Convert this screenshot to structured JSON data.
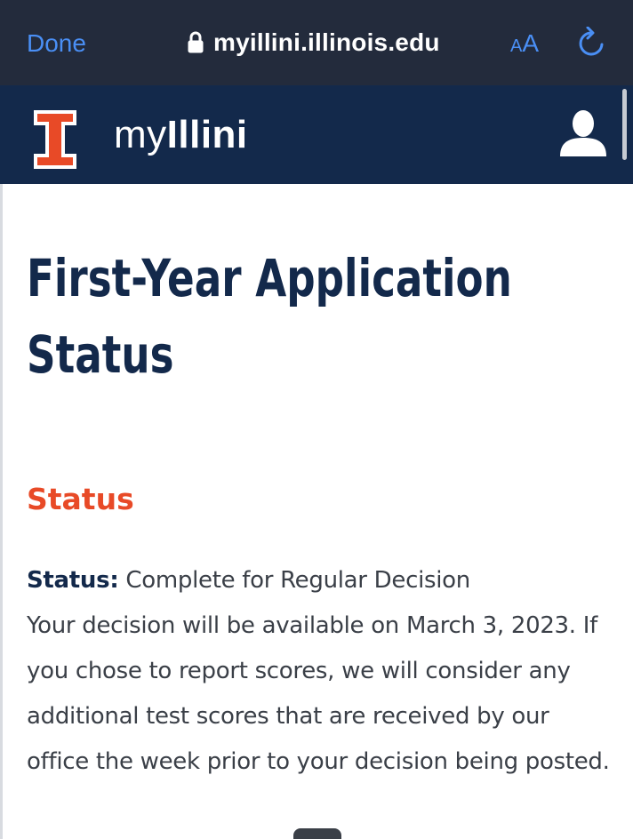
{
  "browser": {
    "done_label": "Done",
    "url": "myillini.illinois.edu",
    "text_size_small": "A",
    "text_size_large": "A"
  },
  "header": {
    "brand_prefix": "my",
    "brand_suffix": "Illini"
  },
  "page": {
    "title": "First-Year Application Status",
    "section_heading": "Status",
    "status_label": "Status:",
    "status_value": "Complete for Regular Decision",
    "status_message": "Your decision will be available on March 3, 2023. If you chose to report scores, we will consider any additional test scores that are received by our office the week prior to your decision being posted."
  },
  "colors": {
    "browser_bar": "#232b3c",
    "link_blue": "#4a8ff5",
    "illini_blue": "#13294b",
    "illini_orange": "#e84a27"
  },
  "icons": [
    "lock-icon",
    "refresh-icon",
    "block-i-logo",
    "user-profile-icon"
  ]
}
